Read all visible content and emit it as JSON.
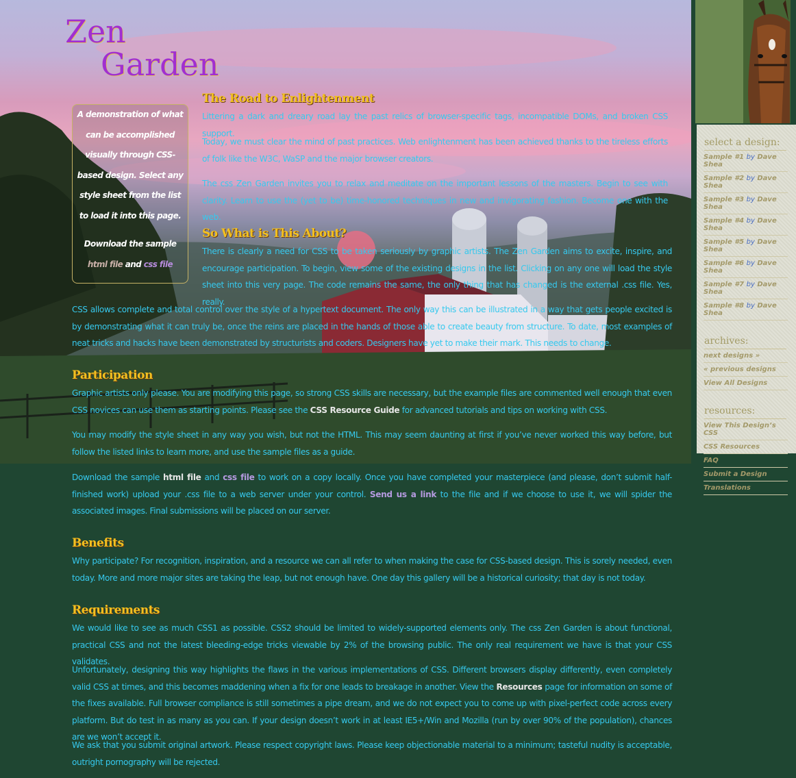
{
  "logo": {
    "line1": "Zen",
    "line2": "Garden"
  },
  "quick_summary": {
    "text1": "A demonstration of what can be accomplished visually through CSS-based design. Select any style sheet from the list to load it into this page.",
    "download_prefix": "Download the sample ",
    "html_link": "html",
    "mid": "file",
    "and": " and ",
    "css_link": "css file"
  },
  "sidebar": {
    "select_title": "select a design:",
    "designs": [
      {
        "name": "Sample #1",
        "by": "by",
        "author": "Dave Shea"
      },
      {
        "name": "Sample #2",
        "by": "by",
        "author": "Dave Shea"
      },
      {
        "name": "Sample #3",
        "by": "by",
        "author": "Dave Shea"
      },
      {
        "name": "Sample #4",
        "by": "by",
        "author": "Dave Shea"
      },
      {
        "name": "Sample #5",
        "by": "by",
        "author": "Dave Shea"
      },
      {
        "name": "Sample #6",
        "by": "by",
        "author": "Dave Shea"
      },
      {
        "name": "Sample #7",
        "by": "by",
        "author": "Dave Shea"
      },
      {
        "name": "Sample #8",
        "by": "by",
        "author": "Dave Shea"
      }
    ],
    "archives_title": "archives:",
    "archives": [
      "next designs »",
      "« previous designs",
      "View All Designs"
    ],
    "resources_title": "resources:",
    "resources": [
      "View This Design’s CSS",
      "CSS Resources",
      "FAQ",
      "Submit a Design",
      "Translations"
    ]
  },
  "sections": {
    "road": {
      "title": "The Road to Enlightenment",
      "p1": "Littering a dark and dreary road lay the past relics of browser-specific tags, incompatible DOMs, and broken CSS support.",
      "p2": "Today, we must clear the mind of past practices. Web enlightenment has been achieved thanks to the tireless efforts of folk like the W3C, WaSP and the major browser creators.",
      "p3": "The css Zen Garden invites you to relax and meditate on the important lessons of the masters. Begin to see with clarity. Learn to use the (yet to be) time-honored techniques in new and invigorating fashion. Become one with the web."
    },
    "about": {
      "title": "So What is This About?",
      "p1": "There is clearly a need for CSS to be taken seriously by graphic artists. The Zen Garden aims to excite, inspire, and encourage participation. To begin, view some of the existing designs in the list. Clicking on any one will load the style sheet into this very page. The code remains the same, the only thing that has changed is the external .css file. Yes, really.",
      "p2": "CSS allows complete and total control over the style of a hypertext document. The only way this can be illustrated in a way that gets people excited is by demonstrating what it can truly be, once the reins are placed in the hands of those able to create beauty from structure. To date, most examples of neat tricks and hacks have been demonstrated by structurists and coders. Designers have yet to make their mark. This needs to change."
    },
    "participation": {
      "title": "Participation",
      "p1a": "Graphic artists only please. You are modifying this page, so strong CSS skills are necessary, but the example files are commented well enough that even CSS novices can use them as starting points. Please see the ",
      "p1_link": "CSS Resource Guide",
      "p1b": " for advanced tutorials and tips on working with CSS.",
      "p2": "You may modify the style sheet in any way you wish, but not the HTML. This may seem daunting at first if you’ve never worked this way before, but follow the listed links to learn more, and use the sample files as a guide.",
      "p3a": "Download the sample ",
      "p3_html": "html file",
      "p3_and": " and ",
      "p3_css": "css file",
      "p3b": " to work on a copy locally. Once you have completed your masterpiece (and please, don’t submit half-finished work) upload your .css file to a web server under your control. ",
      "p3_send": "Send us a link",
      "p3c": " to the file and if we choose to use it, we will spider the associated images. Final submissions will be placed on our server."
    },
    "benefits": {
      "title": "Benefits",
      "p1": "Why participate? For recognition, inspiration, and a resource we can all refer to when making the case for CSS-based design. This is sorely needed, even today. More and more major sites are taking the leap, but not enough have. One day this gallery will be a historical curiosity; that day is not today."
    },
    "requirements": {
      "title": "Requirements",
      "p1": "We would like to see as much CSS1 as possible. CSS2 should be limited to widely-supported elements only. The css Zen Garden is about functional, practical CSS and not the latest bleeding-edge tricks viewable by 2% of the browsing public. The only real requirement we have is that your CSS validates.",
      "p2a": "Unfortunately, designing this way highlights the flaws in the various implementations of CSS. Different browsers display differently, even completely valid CSS at times, and this becomes maddening when a fix for one leads to breakage in another. View the ",
      "p2_link": "Resources",
      "p2b": " page for information on some of the fixes available. Full browser compliance is still sometimes a pipe dream, and we do not expect you to come up with pixel-perfect code across every platform. But do test in as many as you can. If your design doesn’t work in at least IE5+/Win and Mozilla (run by over 90% of the population), chances are we won’t accept it.",
      "p3": "We ask that you submit original artwork. Please respect copyright laws. Please keep objectionable material to a minimum; tasteful nudity is acceptable, outright pornography will be rejected."
    }
  }
}
